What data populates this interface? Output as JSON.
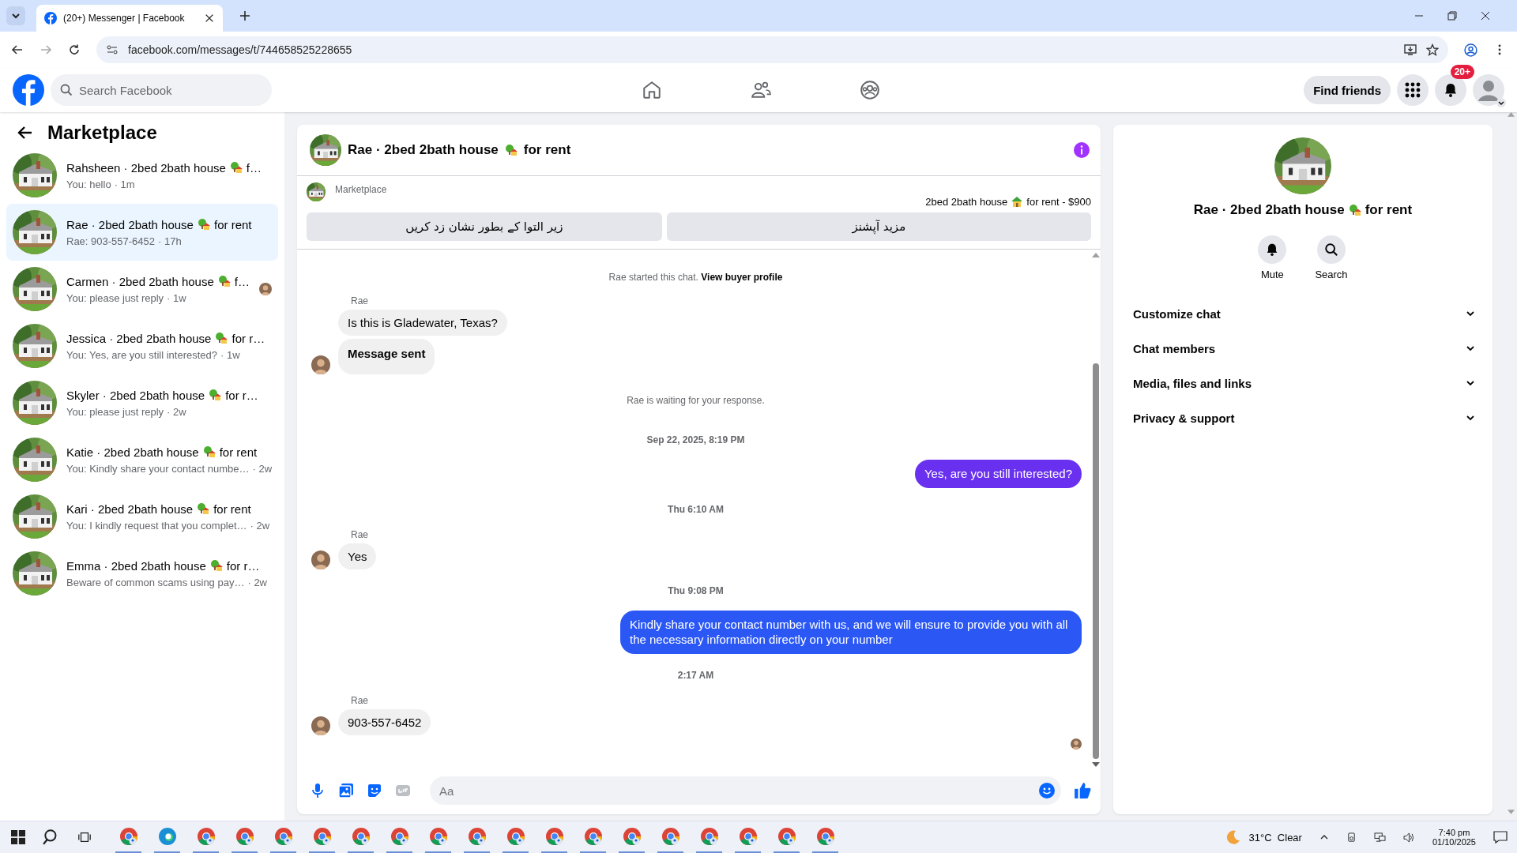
{
  "browser": {
    "tab_title": "(20+) Messenger | Facebook",
    "address": "facebook.com/messages/t/744658525228655"
  },
  "header": {
    "search_placeholder": "Search Facebook",
    "find_friends": "Find friends",
    "notification_badge": "20+"
  },
  "sidebar": {
    "title": "Marketplace",
    "conversations": [
      {
        "name": "Rahsheen · 2bed 2bath house",
        "name_end": "f…",
        "preview": "You: hello",
        "time": "· 1m",
        "selected": false,
        "seen": false
      },
      {
        "name": "Rae · 2bed 2bath house",
        "name_end": "for rent",
        "preview": "Rae: 903-557-6452",
        "time": "· 17h",
        "selected": true,
        "seen": false
      },
      {
        "name": "Carmen · 2bed 2bath house",
        "name_end": "f…",
        "preview": "You: please just reply",
        "time": "· 1w",
        "selected": false,
        "seen": true
      },
      {
        "name": "Jessica · 2bed 2bath house",
        "name_end": "for r…",
        "preview": "You: Yes, are you still interested?",
        "time": "· 1w",
        "selected": false,
        "seen": false
      },
      {
        "name": "Skyler · 2bed 2bath house",
        "name_end": "for r…",
        "preview": "You: please just reply",
        "time": "· 2w",
        "selected": false,
        "seen": false
      },
      {
        "name": "Katie · 2bed 2bath house",
        "name_end": "for rent",
        "preview": "You: Kindly share your contact numbe…",
        "time": "· 2w",
        "selected": false,
        "seen": false
      },
      {
        "name": "Kari · 2bed 2bath house",
        "name_end": "for rent",
        "preview": "You: I kindly request that you complet…",
        "time": "· 2w",
        "selected": false,
        "seen": false
      },
      {
        "name": "Emma · 2bed 2bath house",
        "name_end": "for r…",
        "preview": "Beware of common scams using pay…",
        "time": "· 2w",
        "selected": false,
        "seen": false
      }
    ]
  },
  "chat": {
    "title": "Rae · 2bed 2bath house",
    "title_end": "for rent",
    "listing": {
      "label": "Marketplace",
      "item": "2bed 2bath house",
      "item_end": "for rent - $900",
      "buttons": [
        "مزید آپشنز",
        "زیر التوا کے بطور نشان زد کریں"
      ]
    },
    "messages": [
      {
        "kind": "system",
        "text": "Rae started this chat.",
        "link": "View buyer profile"
      },
      {
        "kind": "incoming",
        "sender": "Rae",
        "bubbles": [
          {
            "text": "Is this is Gladewater, Texas?",
            "bold": false
          },
          {
            "text": "Message sent",
            "bold": true
          }
        ]
      },
      {
        "kind": "notice",
        "text": "Rae is waiting for your response."
      },
      {
        "kind": "time",
        "text": "Sep 22, 2025, 8:19 PM"
      },
      {
        "kind": "outgoing",
        "text": "Yes, are you still interested?",
        "color": "#6930f0"
      },
      {
        "kind": "time",
        "text": "Thu 6:10 AM"
      },
      {
        "kind": "incoming",
        "sender": "Rae",
        "bubbles": [
          {
            "text": "Yes",
            "bold": false
          }
        ]
      },
      {
        "kind": "time",
        "text": "Thu 9:08 PM"
      },
      {
        "kind": "outgoing",
        "text": "Kindly share your contact number with us, and we will ensure to provide you with all the necessary information directly on your number",
        "color": "#2b58f5"
      },
      {
        "kind": "time",
        "text": "2:17 AM"
      },
      {
        "kind": "incoming",
        "sender": "Rae",
        "bubbles": [
          {
            "text": "903-557-6452",
            "bold": false
          }
        ]
      }
    ],
    "seen": true,
    "composer_placeholder": "Aa"
  },
  "info": {
    "title": "Rae · 2bed 2bath house",
    "title_end": "for rent",
    "actions": [
      {
        "kind": "bell",
        "label": "Mute"
      },
      {
        "kind": "search",
        "label": "Search"
      }
    ],
    "sections": [
      "Customize chat",
      "Chat members",
      "Media, files and links",
      "Privacy & support"
    ]
  },
  "taskbar": {
    "weather": "31°C  Clear",
    "time": "7:40 pm",
    "date": "01/10/2025"
  }
}
